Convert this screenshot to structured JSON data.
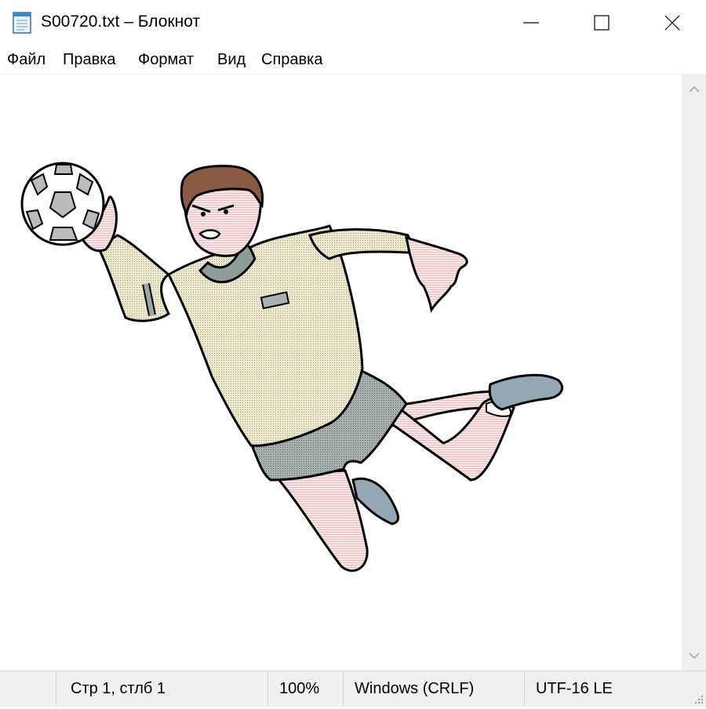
{
  "window": {
    "title": "S00720.txt – Блокнот",
    "app_icon": "notepad-icon",
    "controls": [
      "minimize-icon",
      "maximize-icon",
      "close-icon"
    ]
  },
  "menu": {
    "items": [
      {
        "label": "Файл"
      },
      {
        "label": "Правка"
      },
      {
        "label": "Формат"
      },
      {
        "label": "Вид"
      },
      {
        "label": "Справка"
      }
    ]
  },
  "editor": {
    "content_image": "ascii-art-handball-player-jumping-with-ball"
  },
  "statusbar": {
    "position": "Стр 1, стлб 1",
    "zoom": "100%",
    "line_endings": "Windows (CRLF)",
    "encoding": "UTF-16 LE"
  },
  "colors": {
    "shirt": "#e7e3c6",
    "shorts": "#9aa7a4",
    "skin": "#f6dcdc",
    "hair": "#8b5a45",
    "shoe": "#93a7b4",
    "statusbar": "#f0f0f0"
  }
}
